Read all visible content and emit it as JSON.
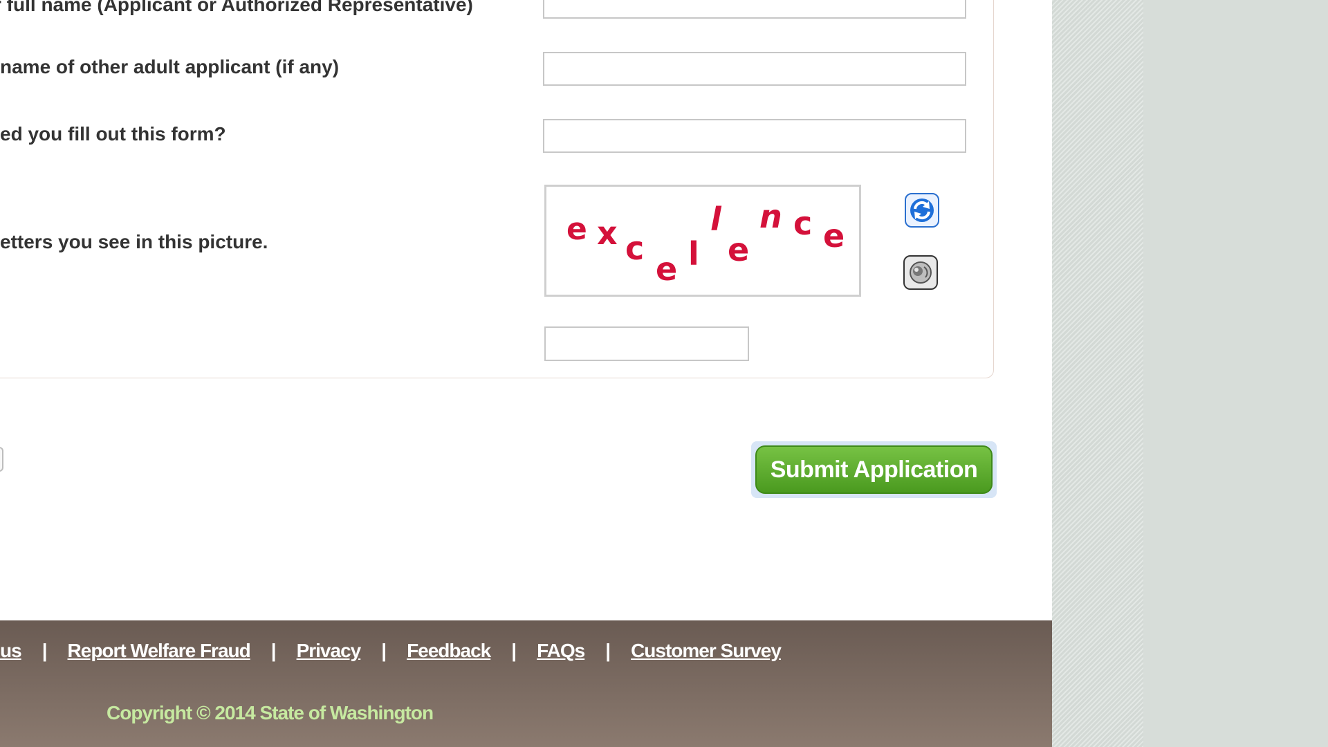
{
  "form": {
    "fields": [
      {
        "label": "r full name (Applicant or Authorized Representative)",
        "value": ""
      },
      {
        "label": "name of other adult applicant (if any)",
        "value": ""
      },
      {
        "label": "ed you fill out this form?",
        "value": ""
      }
    ],
    "captcha": {
      "prompt": "etters you see in this picture.",
      "image_text": "excellence",
      "answer_value": "",
      "refresh_icon": "refresh-arrows-icon",
      "audio_icon": "speaker-audio-icon",
      "text_color": "#d4113a"
    },
    "submit_label": "Submit Application",
    "submit_color": "#4f9f22"
  },
  "footer": {
    "links": [
      "us",
      "Report Welfare Fraud",
      "Privacy",
      "Feedback",
      "FAQs",
      "Customer Survey"
    ],
    "separator": "|",
    "copyright": "Copyright © 2014 State of Washington",
    "background_color": "#7a6a60",
    "copyright_color": "#c6e9a0"
  }
}
